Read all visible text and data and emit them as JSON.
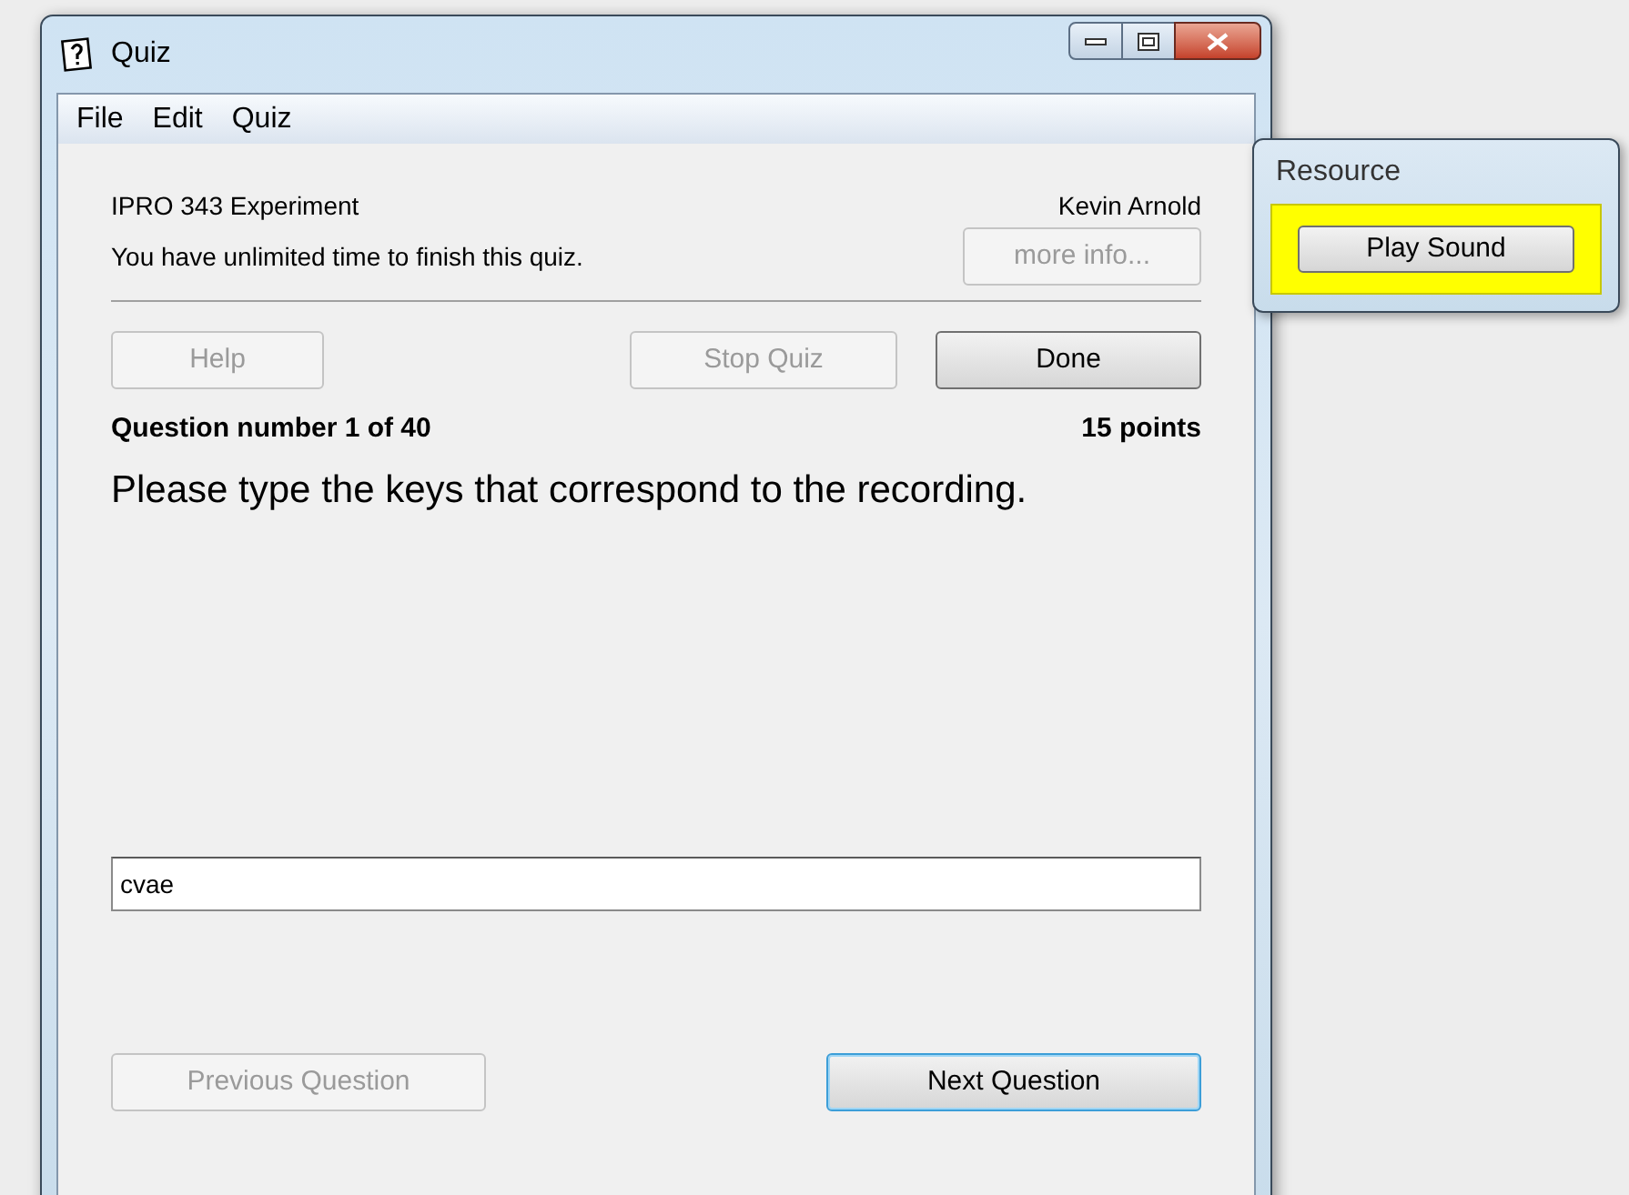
{
  "window": {
    "title": "Quiz"
  },
  "menu": [
    {
      "label": "File"
    },
    {
      "label": "Edit"
    },
    {
      "label": "Quiz"
    }
  ],
  "header": {
    "quiz_name": "IPRO 343 Experiment",
    "user": "Kevin Arnold",
    "time_note": "You have unlimited time to finish this quiz.",
    "info_button": {
      "label": "more info...",
      "disabled": true,
      "default": false
    }
  },
  "top_buttons": [
    {
      "label": "Help",
      "disabled": true,
      "default": false
    },
    {
      "label": "Stop Quiz",
      "disabled": true,
      "default": false
    },
    {
      "label": "Done",
      "disabled": false,
      "default": false
    }
  ],
  "question": {
    "number": "Question number 1 of 40",
    "points": "15 points",
    "text": "Please type the keys that correspond to the recording.",
    "answer": "cvae"
  },
  "bottom_buttons": [
    {
      "label": "Previous Question",
      "disabled": true,
      "default": false
    },
    {
      "label": "Next Question",
      "disabled": false,
      "default": true
    }
  ],
  "resource": {
    "title": "Resource",
    "button": "Play Sound",
    "highlighted": true
  }
}
